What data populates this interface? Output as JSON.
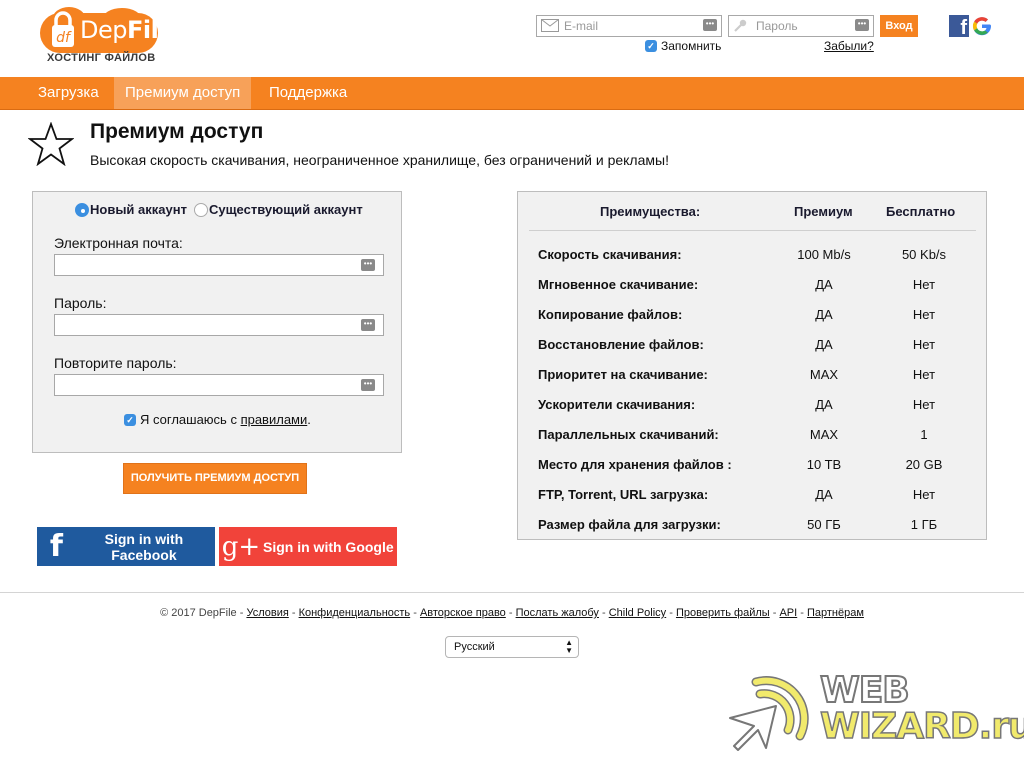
{
  "header": {
    "logo": {
      "name_part1": "Dep",
      "name_part2": "File",
      "tagline": "ХОСТИНГ ФАЙЛОВ"
    },
    "login": {
      "email_placeholder": "E-mail",
      "password_placeholder": "Пароль",
      "login_button": "Вход",
      "remember_label": "Запомнить",
      "remember_checked": true,
      "forgot_link": "Забыли?"
    },
    "social_icons": [
      "facebook-icon",
      "google-icon"
    ]
  },
  "nav": {
    "items": [
      {
        "label": "Загрузка",
        "active": false
      },
      {
        "label": "Премиум доступ",
        "active": true
      },
      {
        "label": "Поддержка",
        "active": false
      }
    ]
  },
  "page": {
    "icon": "star-icon",
    "title": "Премиум доступ",
    "subtitle": "Высокая скорость скачивания, неограниченное хранилище, без ограничений и рекламы!"
  },
  "form": {
    "account_options": [
      {
        "label": "Новый аккаунт",
        "selected": true
      },
      {
        "label": "Существующий аккаунт",
        "selected": false
      }
    ],
    "fields": [
      {
        "label": "Электронная почта:",
        "value": ""
      },
      {
        "label": "Пароль:",
        "value": ""
      },
      {
        "label": "Повторите пароль:",
        "value": ""
      }
    ],
    "agree_prefix": "Я соглашаюсь с ",
    "agree_link": "правилами",
    "agree_suffix": ".",
    "agree_checked": true,
    "submit_label": "ПОЛУЧИТЬ ПРЕМИУМ ДОСТУП",
    "facebook_signin": "Sign in with Facebook",
    "google_signin": "Sign in with Google"
  },
  "comparison": {
    "headers": {
      "feature": "Преимущества:",
      "premium": "Премиум",
      "free": "Бесплатно"
    },
    "rows": [
      {
        "feature": "Скорость скачивания:",
        "premium": "100 Mb/s",
        "free": "50 Kb/s"
      },
      {
        "feature": "Мгновенное скачивание:",
        "premium": "ДА",
        "free": "Нет"
      },
      {
        "feature": "Копирование файлов:",
        "premium": "ДА",
        "free": "Нет"
      },
      {
        "feature": "Восстановление файлов:",
        "premium": "ДА",
        "free": "Нет"
      },
      {
        "feature": "Приоритет на скачивание:",
        "premium": "MAX",
        "free": "Нет"
      },
      {
        "feature": "Ускорители скачивания:",
        "premium": "ДА",
        "free": "Нет"
      },
      {
        "feature": "Параллельных скачиваний:",
        "premium": "MAX",
        "free": "1"
      },
      {
        "feature": "Место для хранения файлов :",
        "premium": "10 TB",
        "free": "20 GB"
      },
      {
        "feature": "FTP, Torrent, URL загрузка:",
        "premium": "ДА",
        "free": "Нет"
      },
      {
        "feature": "Размер файла для загрузки:",
        "premium": "50 ГБ",
        "free": "1 ГБ"
      }
    ]
  },
  "footer": {
    "copyright": "© 2017 DepFile",
    "separator": " - ",
    "links": [
      "Условия",
      "Конфиденциальность",
      "Авторское право",
      "Послать жалобу",
      "Child Policy",
      "Проверить файлы",
      "API",
      "Партнёрам"
    ],
    "language_selected": "Русский"
  },
  "watermark": {
    "line1": "WEB",
    "line2": "WIZARD.ru"
  },
  "colors": {
    "brand_orange": "#f58220",
    "nav_active": "#f7a159",
    "facebook": "#1f5a9e",
    "google": "#f1433a",
    "checkbox_blue": "#3b8fe0"
  }
}
